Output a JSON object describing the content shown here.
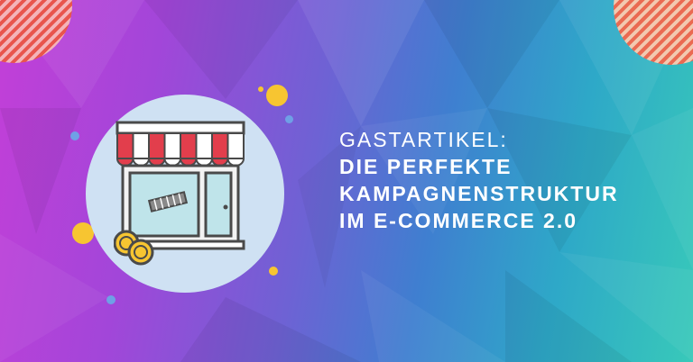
{
  "headline": {
    "kicker": "GASTARTIKEL:",
    "lines": [
      "DIE PERFEKTE",
      "KAMPAGNENSTRUKTUR",
      "IM E-COMMERCE 2.0"
    ]
  },
  "colors": {
    "gradient_left": "#c33fd8",
    "gradient_mid": "#6e62d4",
    "gradient_right": "#38c9b9",
    "icon_circle": "#cfe1f3",
    "accent_yellow": "#f7c531",
    "awning_red": "#e23e4c",
    "outline": "#4a4a4a"
  },
  "icons": [
    "storefront-icon",
    "coin-icon"
  ]
}
